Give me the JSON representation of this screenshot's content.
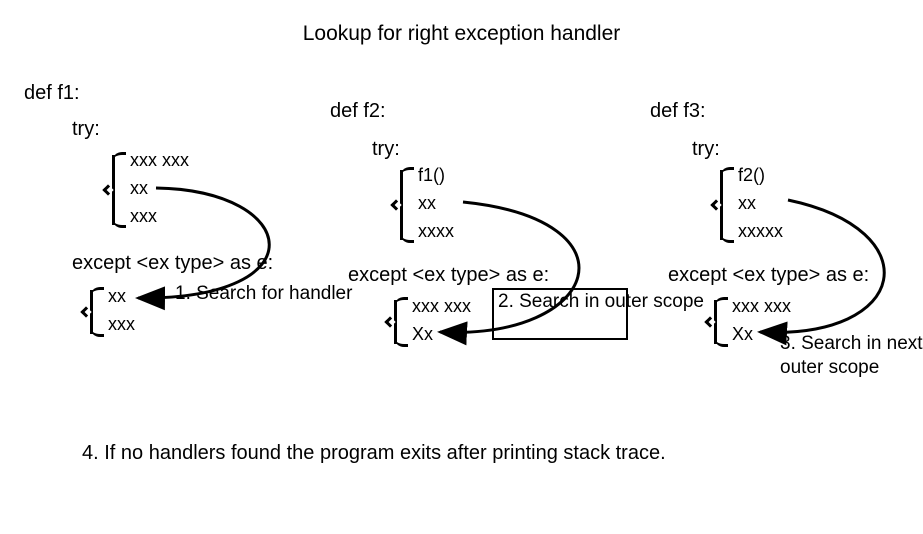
{
  "title": "Lookup for right exception handler",
  "f1": {
    "def": "def f1:",
    "try": "try:",
    "try_lines": [
      "xxx xxx",
      "xx",
      "xxx"
    ],
    "except": "except <ex type> as e:",
    "except_lines": [
      "xx",
      "xxx"
    ]
  },
  "f2": {
    "def": "def f2:",
    "try": "try:",
    "try_lines": [
      "f1()",
      "xx",
      "xxxx"
    ],
    "except": "except <ex type> as e:",
    "except_lines": [
      "xxx xxx",
      "Xx"
    ]
  },
  "f3": {
    "def": "def f3:",
    "try": "try:",
    "try_lines": [
      "f2()",
      "xx",
      "xxxxx"
    ],
    "except": "except <ex type> as e:",
    "except_lines": [
      "xxx xxx",
      "Xx"
    ]
  },
  "notes": {
    "n1": "1. Search\nfor handler",
    "n2": "2. Search\nin outer scope",
    "n3": "3. Search\nin next\nouter scope"
  },
  "footer": "4. If no handlers found the program exits after printing stack trace."
}
